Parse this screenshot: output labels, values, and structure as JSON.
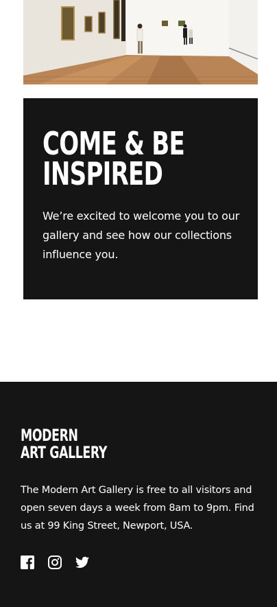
{
  "hero": {
    "image_description": "gallery-interior-photo"
  },
  "card": {
    "heading": "COME & BE INSPIRED",
    "text": "We’re excited to welcome you to our gallery and see how our collections influence you."
  },
  "footer": {
    "logo_line1": "MODERN",
    "logo_line2": "ART GALLERY",
    "text": "The Modern Art Gallery is free to all visitors and open seven days a week from 8am to 9pm. Find us at 99 King Street, Newport, USA.",
    "socials": [
      {
        "icon": "facebook-icon"
      },
      {
        "icon": "instagram-icon"
      },
      {
        "icon": "twitter-icon"
      }
    ]
  },
  "colors": {
    "dark": "#151515",
    "text": "#ffffff",
    "background": "#ffffff"
  }
}
